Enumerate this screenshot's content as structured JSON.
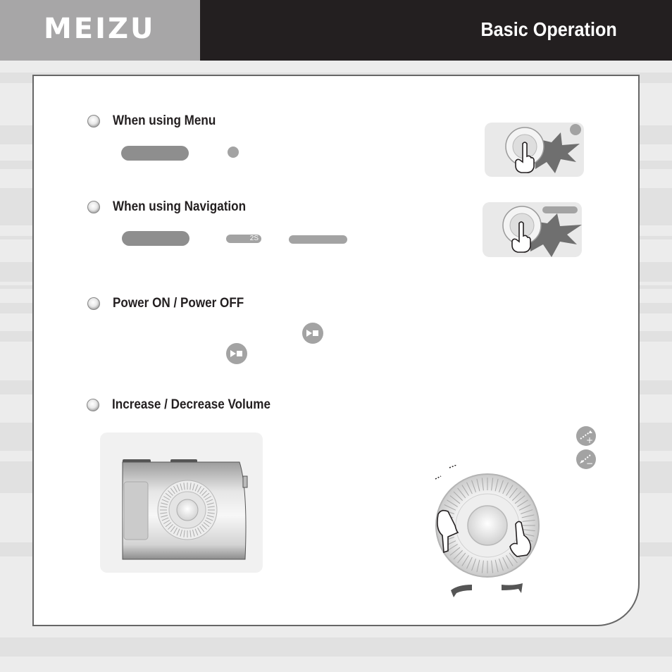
{
  "header": {
    "logo": "MEIZU",
    "title": "Basic Operation"
  },
  "sections": [
    {
      "title": "When using Menu",
      "icon": "radio-bullet-icon"
    },
    {
      "title": "When using Navigation",
      "icon": "radio-bullet-icon",
      "hold_label": "2S"
    },
    {
      "title": "Power ON / Power OFF",
      "icon": "radio-bullet-icon"
    },
    {
      "title": "Increase / Decrease Volume",
      "icon": "radio-bullet-icon"
    }
  ],
  "icons": {
    "play_pause": "play-pause-icon",
    "volume_up": "volume-up-icon",
    "volume_down": "volume-down-icon"
  },
  "volume_icons": {
    "plus": "+",
    "minus": "−"
  },
  "colors": {
    "header_logo_bg": "#a7a6a7",
    "header_title_bg": "#231f20",
    "placeholder_gray": "#8e8e8e",
    "light_gray": "#a3a3a3",
    "frame_border": "#666666"
  }
}
